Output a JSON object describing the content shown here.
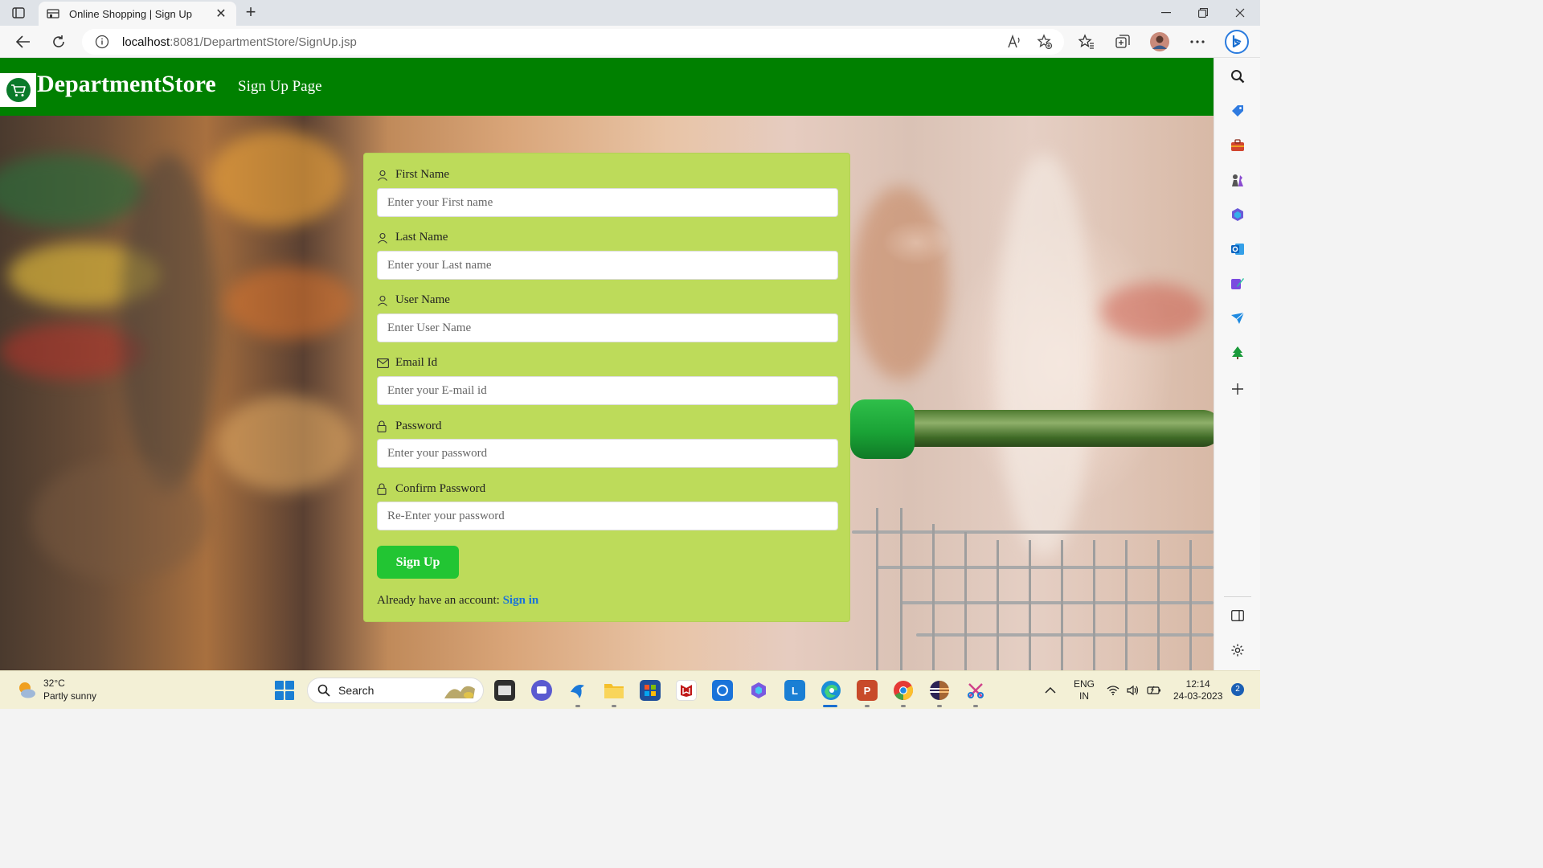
{
  "browser": {
    "tab_title": "Online Shopping | Sign Up",
    "tab_close": "✕",
    "new_tab": "+",
    "url_host": "localhost",
    "url_rest": ":8081/DepartmentStore/SignUp.jsp"
  },
  "site": {
    "brand": "DepartmentStore",
    "nav_link": "Sign Up Page"
  },
  "form": {
    "first_name_label": "First Name",
    "first_name_placeholder": "Enter your First name",
    "last_name_label": "Last Name",
    "last_name_placeholder": "Enter your Last name",
    "user_name_label": "User Name",
    "user_name_placeholder": "Enter User Name",
    "email_label": "Email Id",
    "email_placeholder": "Enter your E-mail id",
    "password_label": "Password",
    "password_placeholder": "Enter your password",
    "confirm_label": "Confirm Password",
    "confirm_placeholder": "Re-Enter your password",
    "submit": "Sign Up",
    "already_text": "Already have an account: ",
    "signin_link": "Sign in"
  },
  "taskbar": {
    "temp": "32°C",
    "weather": "Partly sunny",
    "search": "Search",
    "lang": "ENG",
    "region": "IN",
    "time": "12:14",
    "date": "24-03-2023",
    "notif_count": "2"
  },
  "colors": {
    "header_green": "#008000",
    "card": "#bddb5a",
    "button": "#22c533",
    "link": "#1a73d9"
  }
}
